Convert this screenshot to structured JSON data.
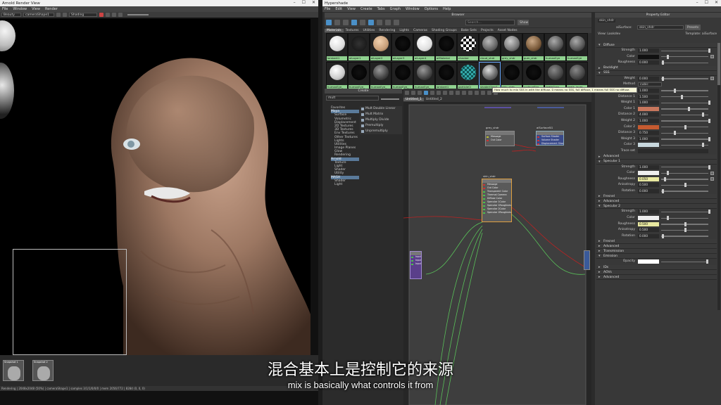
{
  "render_window": {
    "title": "Arnold Render View",
    "menus": [
      "File",
      "Window",
      "View",
      "Render"
    ],
    "toolbar": {
      "mode": "Beauty",
      "camera": "cameraShape1",
      "shading": "Shading"
    },
    "snapshots": [
      "Snapshot 1",
      "Snapshot 2"
    ],
    "status": "Rendering | 2048x2048 (50%) | cameraShape1 | samples 3/1/1/0/0/0 | mem 2056/772 | 8284 (0, 0, 0)"
  },
  "hypershade": {
    "title": "Hypershade",
    "menus": [
      "File",
      "Edit",
      "View",
      "Create",
      "Tabs",
      "Graph",
      "Window",
      "Options",
      "Help"
    ],
    "browser": {
      "title": "Browser",
      "search_placeholder": "Search...",
      "show_label": "Show",
      "tabs": [
        "Materials",
        "Textures",
        "Utilities",
        "Rendering",
        "Lights",
        "Cameras",
        "Shading Groups",
        "Bake Sets",
        "Projects",
        "Asset Nodes"
      ],
      "active_tab": "Materials",
      "row1": [
        "lambert1",
        "aiLayer1",
        "aiLayer2",
        "aiLayer3",
        "aiLayer4",
        "aiMaterial",
        "checker",
        "cloud_shdr",
        "grey_shdr",
        "gum_shdr",
        "humanEye",
        "humanEye"
      ],
      "row2": [
        "humanEye_",
        "humanEye_",
        "humanEye_",
        "humanEye_",
        "humanEye_",
        "lambert1",
        "particleCl",
        "shaderGlow1",
        "skin_shdr",
        "surfaceSha",
        "teethGrav",
        "teeth_layer"
      ]
    },
    "tooltip": "How much to mix SSS in with the diffuse. 0 means no SSS, full diffuse, 1 means full SSS no diffuse.",
    "create": {
      "title": "Create",
      "search": "mult",
      "tree": [
        "Favorites",
        "Maya",
        "Surface",
        "Volumetric",
        "Displacement",
        "2D Textures",
        "3D Textures",
        "Env Textures",
        "Other Textures",
        "Lights",
        "Utilities",
        "Image Planes",
        "Glow",
        "Rendering",
        "Arnold",
        "Texture",
        "Light",
        "Shader",
        "Utility",
        "MASH",
        "Shader",
        "Light"
      ],
      "results": [
        "Mult Double Linear",
        "Mult Matrix",
        "Multiply Divide",
        "Premultiply",
        "Unpremultiply"
      ]
    },
    "graph": {
      "tabs": [
        "Untitled_1",
        "Untitled_2"
      ],
      "nodes": {
        "grey": {
          "title": "grey_shdr",
          "rows": [
            "Message",
            "Out Color"
          ]
        },
        "sg": {
          "title": "aiSurfaceSG",
          "rows": [
            "Surface Shader",
            "Volume Shader",
            "Displacement Shader"
          ]
        },
        "skin": {
          "title": "skin_shdr",
          "rows": [
            "Message",
            "Out Color",
            "Transparent Color",
            "Thermal Camera",
            "Diffuse Color",
            "Specular 1Color",
            "Specular 1Roughness",
            "Specular 2Color",
            "Specular 2Roughness"
          ]
        },
        "layer": {
          "rows": [
            "Input 1D",
            "Input 2D",
            "Input 3D"
          ]
        }
      }
    }
  },
  "property_editor": {
    "title": "Property Editor",
    "node": "skin_shdr",
    "type_label": "aiSurface:",
    "type_value": "skin_shdr",
    "presets": "Presets",
    "view": "View: Lookdev",
    "template": "Template: aiSurface",
    "sections": {
      "diffuse": "Diffuse",
      "backlight": "Backlight",
      "sss": "SSS",
      "advanced": "Advanced",
      "specular1": "Specular 1",
      "fresnel": "Fresnel",
      "specular2": "Specular 2",
      "transmission": "Transmission",
      "emission": "Emission",
      "ids": "IDs",
      "aovs": "AOVs",
      "adv2": "Advanced"
    },
    "diffuse_rows": [
      {
        "label": "Strength",
        "value": "1.000"
      },
      {
        "label": "Color",
        "value": ""
      },
      {
        "label": "Roughness",
        "value": "0.000"
      }
    ],
    "sss_rows": [
      {
        "label": "Weight",
        "value": "0.000"
      },
      {
        "label": "Method",
        "value": "cubic"
      },
      {
        "label": "Density scale",
        "value": "1.000"
      },
      {
        "label": "Distance 1",
        "value": "1.500"
      },
      {
        "label": "Weight 1",
        "value": "1.000"
      },
      {
        "label": "Color 1",
        "value": ""
      },
      {
        "label": "Distance 2",
        "value": "4.000"
      },
      {
        "label": "Weight 2",
        "value": "1.000"
      },
      {
        "label": "Color 2",
        "value": ""
      },
      {
        "label": "Distance 3",
        "value": "0.750"
      },
      {
        "label": "Weight 3",
        "value": "1.000"
      },
      {
        "label": "Color 3",
        "value": ""
      },
      {
        "label": "Trace set",
        "value": ""
      }
    ],
    "spec1_rows": [
      {
        "label": "Strength",
        "value": "1.000"
      },
      {
        "label": "Color",
        "value": ""
      },
      {
        "label": "Roughness",
        "value": "0.050"
      },
      {
        "label": "Anisotropy",
        "value": "0.500"
      },
      {
        "label": "Rotation",
        "value": "0.000"
      }
    ],
    "spec2_rows": [
      {
        "label": "Strength",
        "value": "1.000"
      },
      {
        "label": "Color",
        "value": ""
      },
      {
        "label": "Roughness",
        "value": "0.500"
      },
      {
        "label": "Anisotropy",
        "value": "0.500"
      },
      {
        "label": "Rotation",
        "value": "0.000"
      }
    ],
    "opacity": "Opacity"
  },
  "subtitles": {
    "cn": "混合基本上是控制它的来源",
    "en": "mix is basically what controls it from"
  }
}
